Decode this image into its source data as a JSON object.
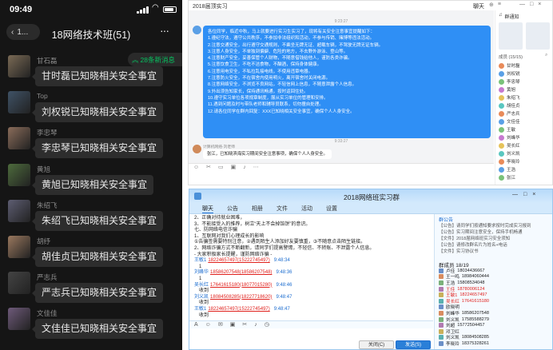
{
  "phone": {
    "time": "09:49",
    "back_label": "1...",
    "title": "18网络技术班(51)",
    "new_msg": "28条新消息",
    "messages": [
      {
        "name": "甘石磊",
        "text": "甘时磊已知晓相关安全事宜"
      },
      {
        "name": "Top",
        "text": "刘权锐已知晓相关安全事宜"
      },
      {
        "name": "李忠琴",
        "text": "李忠琴已知晓相关安全事宜"
      },
      {
        "name": "黄旭",
        "text": "黄旭已知晓相关安全事宜"
      },
      {
        "name": "朱绍飞",
        "text": "朱绍飞已知晓相关安全事宜"
      },
      {
        "name": "胡纾",
        "text": "胡佳贞已知晓相关安全事宜"
      },
      {
        "name": "严志兵",
        "text": "严志兵已知晓相关安全事宜"
      },
      {
        "name": "文佳佳",
        "text": "文佳佳已知晓相关安全事宜"
      }
    ]
  },
  "tim": {
    "title": "2018届顶实习",
    "tab": "聊天",
    "notice_label": "群通知",
    "time1": "9:23:27",
    "notice_lines": [
      "各位同学，临近中秋，马上就要进行实习生实习了，现将有关安全注意事宜提醒如下：",
      "1.遵纪守法，遵守公共秩序，不参加非法组织和活动，不参与传销、赌博等违法活动。",
      "2.注意交通安全，出行遵守交通规则，不乘坐无牌无证、超载车辆，不驾驶无牌无证车辆。",
      "3.注意人身安全，不单独到偏僻、危险的地方，不去野外游泳、登山等。",
      "4.注意财产安全，妥善保管个人财物，不随意借钱给他人，谨防各类诈骗。",
      "5.注意饮食卫生，不吃不洁食物，不酗酒，保持身体健康。",
      "6.注意用电安全，不私拉乱接电线，不使用违章电器。",
      "7.注意防火安全，不在宿舍内使用明火，离开宿舍时关闭电源。",
      "8.注意网络安全，不浏览不良网站，不轻信网上信息，不随意泄露个人信息。",
      "9.外出须告知家长，保持通讯畅通，按时返回住处。",
      "10.遵守实习单位各项规章制度，服从实习单位的管理和安排。",
      "11.遇到问题及时与带队老师和辅导员联系，切勿擅自处理。",
      "12.请各位同学在群内回复：XXX已知晓相关安全事宜，确保个人人身安全。"
    ],
    "time2": "9:33:27",
    "sender2": "计算机网络-刘老师",
    "reply": "张江，已知晓滨海实习期间安全注意事项，确保个人人身安全。",
    "members_label": "成员 (15/15)",
    "members": [
      "甘时磊",
      "刘权锐",
      "李忠琴",
      "黄旭",
      "朱绍飞",
      "胡佳贞",
      "严志兵",
      "文佳佳",
      "王敏",
      "刘峰华",
      "吴长红",
      "刘义凯",
      "李晓玲",
      "王浩",
      "张江"
    ]
  },
  "qq": {
    "title": "2018网络班实习群",
    "tabs": [
      "聊天",
      "公告",
      "相册",
      "文件",
      "活动",
      "设置"
    ],
    "lines": [
      "2、正确对待就业困难，",
      "3、不能接受入的推荐，树立“天上不会掉馅饼”的意识。",
      "七、防网络电信诈骗",
      "1、互联网对我们心理成长的影响",
      "①告骗签需要特别注意，②遇到陌生人添加好友要慎重，③不随意点击陌生链接。",
      "2、网络诈骗方式不断翻新，请同学们提高警惕，不轻信、不转账、不泄露个人信息。",
      "- 大家积极家长提醒，谨防网络诈骗 -"
    ],
    "messages": [
      {
        "sender": "王敏1",
        "contact": "18224657497(15222745497)",
        "time": "9:48:34",
        "text": "1"
      },
      {
        "sender": "刘峰华",
        "contact": "18586207548(18586207548)",
        "time": "9:48:36",
        "text": "1"
      },
      {
        "sender": "吴长红",
        "contact": "17641615180(18077015280)",
        "time": "9:48:46",
        "text": "收到"
      },
      {
        "sender": "刘义凯",
        "contact": "18084508285(18227718620)",
        "time": "9:48:47",
        "text": "收到"
      },
      {
        "sender": "王敏1",
        "contact": "18224657497(15222745497)",
        "time": "9:48:47",
        "text": "收到"
      }
    ],
    "announce_label": "群公告",
    "announce_lines": [
      "【公告】请同学们按通知要求按时完成实习报到",
      "【公告】实习期间注意安全，保持手机畅通",
      "【文件】2018届网络班实习安全须知",
      "【公告】请修改群名片为姓名+电话",
      "【文件】实习协议书"
    ],
    "members_label": "群成员 18/19",
    "members": [
      {
        "name": "卢佳",
        "phone": "18034436667",
        "hl": false
      },
      {
        "name": "王一鸣",
        "phone": "18984060444",
        "hl": false
      },
      {
        "name": "王浩",
        "phone": "15808534048",
        "hl": false
      },
      {
        "name": "王佳",
        "phone": "18780006124",
        "hl": true
      },
      {
        "name": "王敏1",
        "phone": "18224657497",
        "hl": true
      },
      {
        "name": "吴长红",
        "phone": "17641615180",
        "hl": true
      },
      {
        "name": "欧晓明",
        "phone": "",
        "hl": false
      },
      {
        "name": "刘峰华",
        "phone": "18586207548",
        "hl": false
      },
      {
        "name": "刘义凯",
        "phone": "17585588279",
        "hl": false
      },
      {
        "name": "刘超",
        "phone": "15772504457",
        "hl": false
      },
      {
        "name": "邓卫红",
        "phone": "",
        "hl": false
      },
      {
        "name": "刘义凯",
        "phone": "18084508285",
        "hl": false
      },
      {
        "name": "李晓玲",
        "phone": "18375328261",
        "hl": false
      }
    ],
    "close_label": "关闭(C)",
    "send_label": "发送(S)"
  },
  "colors": {
    "wechat_green": "#07c160",
    "tim_blue": "#2f8ff5",
    "qq_red": "#e0201c",
    "qq_blue": "#1c6dd0"
  },
  "icons": [
    "chevron-left-icon",
    "more-icon",
    "double-chevron-up-icon",
    "signal-icon",
    "wifi-icon",
    "battery-icon",
    "emoji-icon",
    "scissors-icon",
    "folder-icon",
    "image-icon",
    "bell-icon",
    "search-icon"
  ]
}
